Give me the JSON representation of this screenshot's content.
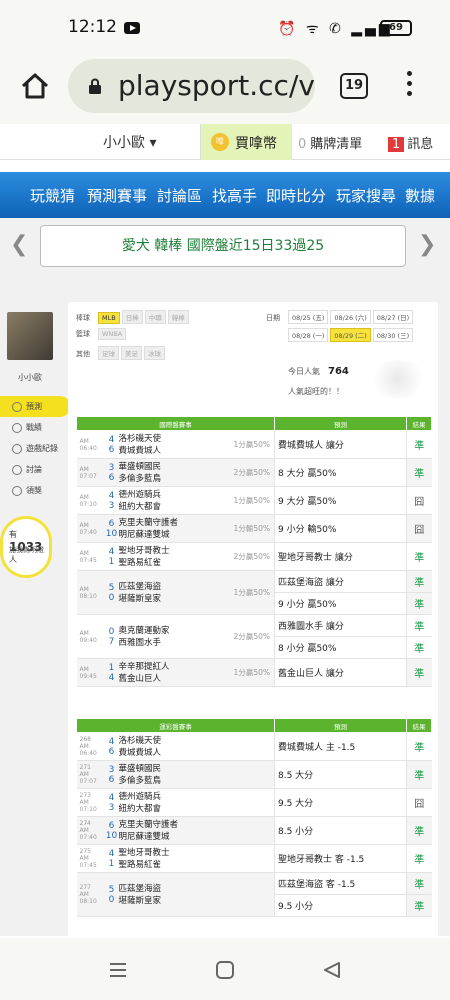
{
  "status": {
    "time": "12:12",
    "battery": "69"
  },
  "browser": {
    "url": "playsport.cc/v",
    "tab_count": "19"
  },
  "topnav": {
    "user": "小小歐",
    "coin_label": "買嗱幣",
    "coin_icon": "嗱",
    "cart_count": "0",
    "cart_label": "購牌清單",
    "msg_count": "1",
    "msg_label": "訊息"
  },
  "bluenav": [
    "玩競猜",
    "預測賽事",
    "討論區",
    "找高手",
    "即時比分",
    "玩家搜尋",
    "數據"
  ],
  "marquee": "愛犬 韓棒 國際盤近15日33過25",
  "sidebar": {
    "name": "小小歐",
    "menu": [
      "預測",
      "戰績",
      "遊戲紀錄",
      "討論",
      "領獎"
    ],
    "count": "1033",
    "count_unit": "人",
    "count_text": "加我為明燈"
  },
  "filters": {
    "rows": [
      {
        "label": "棒球",
        "chips": [
          "MLB",
          "日棒",
          "中職",
          "韓棒"
        ],
        "active": 0
      },
      {
        "label": "籃球",
        "chips": [
          "WNBA"
        ],
        "active": -1
      },
      {
        "label": "其他",
        "chips": [
          "足球",
          "美足",
          "冰球"
        ],
        "active": -1
      }
    ],
    "date_label": "日期",
    "dates": [
      "08/25 (五)",
      "08/26 (六)",
      "08/27 (日)",
      "08/28 (一)",
      "08/29 (二)",
      "08/30 (三)"
    ],
    "date_active": 4
  },
  "popularity": {
    "label": "今日人氣",
    "value": "764",
    "note": "人氣超旺的！！"
  },
  "intl": {
    "headers": [
      "國際盤賽事",
      "預測",
      "結果"
    ],
    "rows": [
      {
        "time": "AM 06:40",
        "s1": "4",
        "s2": "6",
        "t1": "洛杉磯天使",
        "t2": "費城費城人",
        "spread": "1分贏50%",
        "pred": [
          "費城費城人 讓分"
        ],
        "res": [
          "準"
        ]
      },
      {
        "time": "AM 07:07",
        "s1": "3",
        "s2": "6",
        "t1": "華盛頓國民",
        "t2": "多倫多藍鳥",
        "spread": "2分贏50%",
        "pred": [
          "8 大分 贏50%"
        ],
        "res": [
          "準"
        ]
      },
      {
        "time": "AM 07:10",
        "s1": "4",
        "s2": "3",
        "t1": "德州遊騎兵",
        "t2": "紐約大都會",
        "spread": "1分贏50%",
        "pred": [
          "9 大分 贏50%"
        ],
        "res": [
          "囧"
        ]
      },
      {
        "time": "AM 07:40",
        "s1": "6",
        "s2": "10",
        "t1": "克里夫蘭守護者",
        "t2": "明尼蘇達雙城",
        "spread": "1分輸50%",
        "pred": [
          "9 小分 輸50%"
        ],
        "res": [
          "囧"
        ]
      },
      {
        "time": "AM 07:45",
        "s1": "4",
        "s2": "1",
        "t1": "聖地牙哥教士",
        "t2": "聖路易紅雀",
        "spread": "2分贏50%",
        "pred": [
          "聖地牙哥教士 讓分"
        ],
        "res": [
          "準"
        ]
      },
      {
        "time": "AM 08:10",
        "s1": "5",
        "s2": "0",
        "t1": "匹茲堡海盜",
        "t2": "堪薩斯皇家",
        "spread": "1分贏50%",
        "pred": [
          "匹茲堡海盜 讓分",
          "9 小分 贏50%"
        ],
        "res": [
          "準",
          "準"
        ]
      },
      {
        "time": "AM 09:40",
        "s1": "0",
        "s2": "7",
        "t1": "奧克蘭運動家",
        "t2": "西雅圖水手",
        "spread": "2分贏50%",
        "pred": [
          "西雅圖水手 讓分",
          "8 小分 贏50%"
        ],
        "res": [
          "準",
          "準"
        ]
      },
      {
        "time": "AM 09:45",
        "s1": "1",
        "s2": "4",
        "t1": "辛辛那提紅人",
        "t2": "舊金山巨人",
        "spread": "1分贏50%",
        "pred": [
          "舊金山巨人 讓分"
        ],
        "res": [
          "準"
        ]
      }
    ]
  },
  "local": {
    "headers": [
      "運彩盤賽事",
      "預測",
      "結果"
    ],
    "rows": [
      {
        "no": "268",
        "time": "AM 06:40",
        "s1": "4",
        "s2": "6",
        "t1": "洛杉磯天使",
        "t2": "費城費城人",
        "pred": [
          "費城費城人 主 -1.5"
        ],
        "res": [
          "準"
        ]
      },
      {
        "no": "271",
        "time": "AM 07:07",
        "s1": "3",
        "s2": "6",
        "t1": "華盛頓國民",
        "t2": "多倫多藍鳥",
        "pred": [
          "8.5 大分"
        ],
        "res": [
          "準"
        ]
      },
      {
        "no": "273",
        "time": "AM 07:10",
        "s1": "4",
        "s2": "3",
        "t1": "德州遊騎兵",
        "t2": "紐約大都會",
        "pred": [
          "9.5 大分"
        ],
        "res": [
          "囧"
        ]
      },
      {
        "no": "274",
        "time": "AM 07:40",
        "s1": "6",
        "s2": "10",
        "t1": "克里夫蘭守護者",
        "t2": "明尼蘇達雙城",
        "pred": [
          "8.5 小分"
        ],
        "res": [
          "準"
        ]
      },
      {
        "no": "275",
        "time": "AM 07:45",
        "s1": "4",
        "s2": "1",
        "t1": "聖地牙哥教士",
        "t2": "聖路易紅雀",
        "pred": [
          "聖地牙哥教士 客 -1.5"
        ],
        "res": [
          "準"
        ]
      },
      {
        "no": "277",
        "time": "AM 08:10",
        "s1": "5",
        "s2": "0",
        "t1": "匹茲堡海盜",
        "t2": "堪薩斯皇家",
        "pred": [
          "匹茲堡海盜 客 -1.5",
          "9.5 小分"
        ],
        "res": [
          "準",
          "準"
        ]
      }
    ]
  }
}
